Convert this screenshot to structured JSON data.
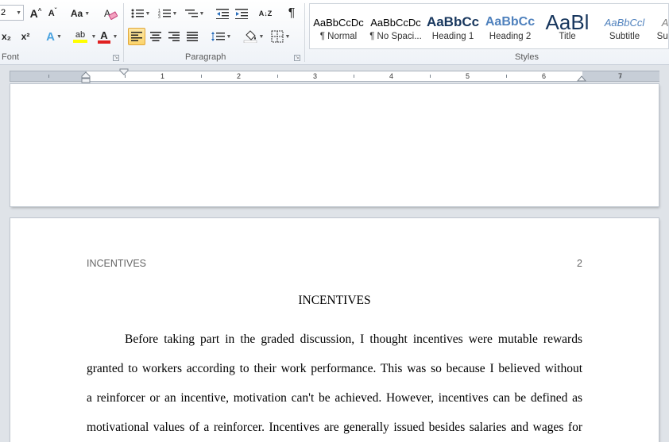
{
  "ribbon": {
    "font_group": {
      "label": "Font",
      "font_size_value": "2",
      "grow_font": "A",
      "shrink_font": "A",
      "change_case": "Aa",
      "subscript": "x₂",
      "superscript": "x²",
      "text_effects": "A",
      "highlight": "ab",
      "font_color": "A",
      "clear_format": "A"
    },
    "paragraph_group": {
      "label": "Paragraph",
      "pilcrow": "¶",
      "sort": "A↓Z"
    },
    "styles_group": {
      "label": "Styles",
      "tiles": [
        {
          "sample": "AaBbCcDc",
          "name": "¶ Normal"
        },
        {
          "sample": "AaBbCcDc",
          "name": "¶ No Spaci..."
        },
        {
          "sample": "AaBbCc",
          "name": "Heading 1"
        },
        {
          "sample": "AaBbCc",
          "name": "Heading 2"
        },
        {
          "sample": "AaBl",
          "name": "Title"
        },
        {
          "sample": "AaBbCcl",
          "name": "Subtitle"
        },
        {
          "sample": "AaBbCcl",
          "name": "Subtle Em..."
        }
      ]
    }
  },
  "ruler": {
    "numbers": [
      "1",
      "2",
      "3",
      "4",
      "5",
      "6",
      "7"
    ]
  },
  "document": {
    "page2": {
      "running_head": "INCENTIVES",
      "page_number": "2",
      "title": "INCENTIVES",
      "lines": [
        "Before taking part in the graded discussion, I thought incentives were mutable rewards",
        "granted to workers according to their work performance. This was so because I believed without",
        "a reinforcer or an incentive, motivation can't be achieved. However, incentives can be defined as",
        "motivational values of a reinforcer. Incentives are generally issued besides salaries and wages for"
      ]
    }
  },
  "colors": {
    "highlight_yellow": "#ffff00",
    "font_color_red": "#e02020",
    "heading_blue": "#17365d",
    "heading2_blue": "#4f81bd",
    "active_button": "#fbd46a"
  }
}
